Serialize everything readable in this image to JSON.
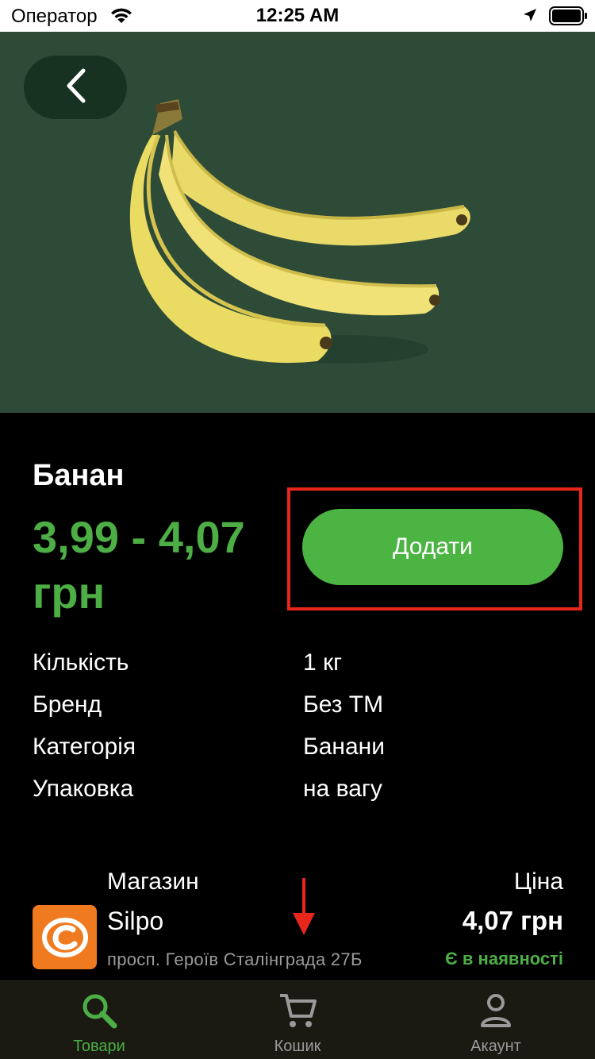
{
  "status_bar": {
    "carrier": "Оператор",
    "time": "12:25 AM"
  },
  "hero": {
    "image": "banana-bunch",
    "background_color": "#2e4b38"
  },
  "product": {
    "title": "Банан",
    "price": "3,99 - 4,07 грн",
    "add_label": "Додати",
    "accent_color": "#4cae45",
    "details": [
      {
        "key": "Кількість",
        "value": "1 кг"
      },
      {
        "key": "Бренд",
        "value": "Без ТМ"
      },
      {
        "key": "Категорія",
        "value": "Банани"
      },
      {
        "key": "Упаковка",
        "value": "на вагу"
      }
    ]
  },
  "store": {
    "label": "Магазин",
    "name": "Silpo",
    "address": "просп. Героїв Сталінграда 27Б",
    "price_label": "Ціна",
    "price": "4,07 грн",
    "availability": "Є в наявності"
  },
  "tabs": [
    {
      "label": "Товари",
      "icon": "search-icon",
      "active": true
    },
    {
      "label": "Кошик",
      "icon": "cart-icon",
      "active": false
    },
    {
      "label": "Акаунт",
      "icon": "account-icon",
      "active": false
    }
  ]
}
